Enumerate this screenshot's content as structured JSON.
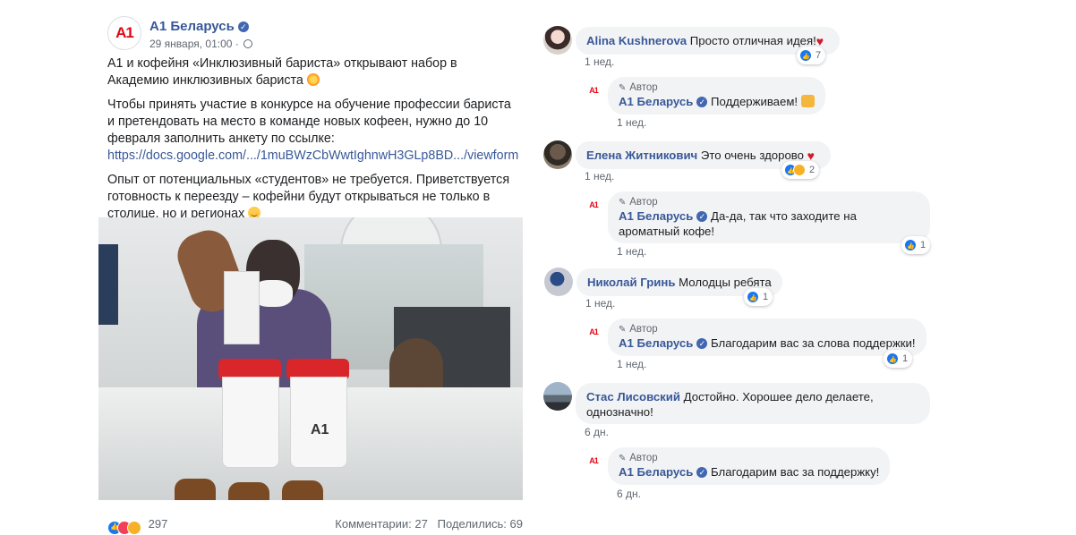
{
  "post": {
    "page_name": "A1 Беларусь",
    "logo_text": "A1",
    "date": "29 января, 01:00 ·",
    "paragraphs": [
      "A1 и кофейня «Инклюзивный бариста» открывают набор в Академию инклюзивных бариста",
      "Чтобы принять участие в конкурсе на обучение профессии бариста и претендовать на место в команде новых кофеен, нужно до 10 февраля заполнить анкету по ссылке:",
      "Опыт от потенциальных «студентов» не требуется. Приветствуется готовность к переезду – кофейни будут открываться не только в столице, но и регионах"
    ],
    "link": "https://docs.google.com/.../1muBWzCbWwtIghnwH3GLp8BD.../viewform",
    "photo_cup_text": "A1",
    "reactions_count": "297",
    "comments_count": "Комментарии: 27",
    "shares_count": "Поделились: 69"
  },
  "comments": [
    {
      "name": "Alina Kushnerova",
      "text": "Просто отличная идея!",
      "time": "1 нед.",
      "reactions": "7"
    },
    {
      "author_tag": "Автор",
      "name": "A1 Беларусь",
      "text": "Поддерживаем!",
      "time": "1 нед."
    },
    {
      "name": "Елена Житникович",
      "text": "Это очень здорово",
      "time": "1 нед.",
      "reactions": "2"
    },
    {
      "author_tag": "Автор",
      "name": "A1 Беларусь",
      "text": "Да-да, так что заходите на ароматный кофе!",
      "time": "1 нед.",
      "reactions": "1"
    },
    {
      "name": "Николай Гринь",
      "text": "Молодцы ребята",
      "time": "1 нед.",
      "reactions": "1"
    },
    {
      "author_tag": "Автор",
      "name": "A1 Беларусь",
      "text": "Благодарим вас за слова поддержки!",
      "time": "1 нед.",
      "reactions": "1"
    },
    {
      "name": "Стас Лисовский",
      "text": "Достойно. Хорошее дело делаете, однозначно!",
      "time": "6 дн."
    },
    {
      "author_tag": "Автор",
      "name": "A1 Беларусь",
      "text": "Благодарим вас за поддержку!",
      "time": "6 дн."
    }
  ],
  "colors": {
    "link": "#385898",
    "brand": "#e30613",
    "bubble": "#f2f3f5"
  }
}
